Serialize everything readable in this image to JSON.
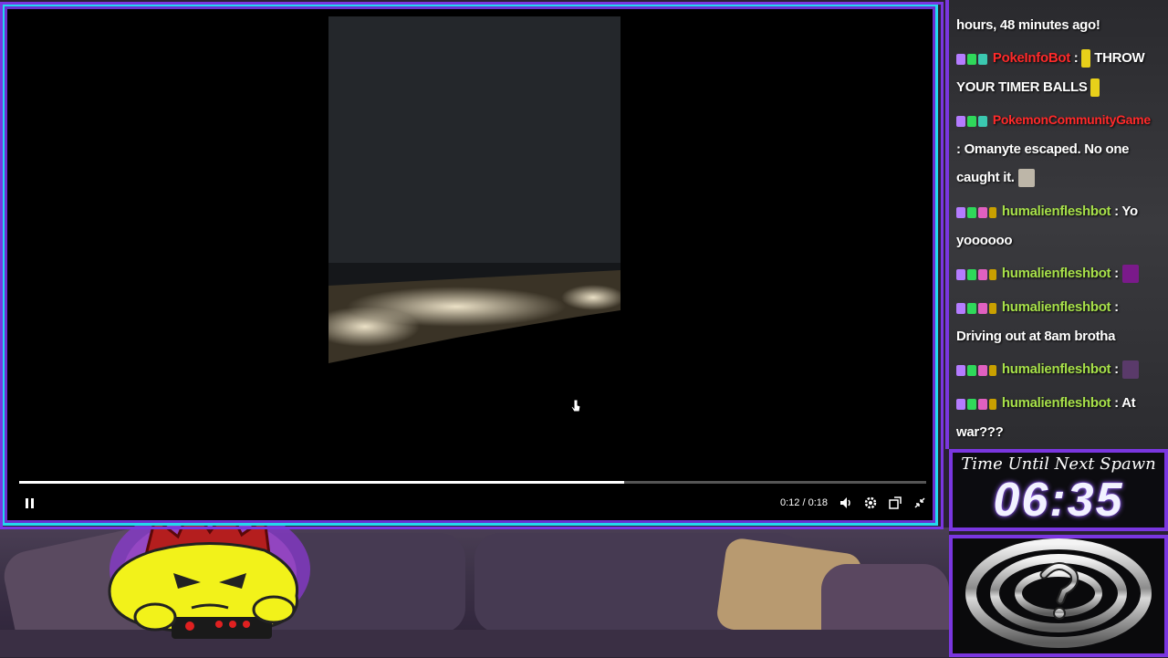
{
  "video": {
    "time_current": "0:12",
    "time_total": "0:18",
    "time_sep": " / ",
    "progress": 0.667,
    "pause_icon": "pause-icon",
    "volume_icon": "volume-icon",
    "settings_icon": "gear-icon",
    "popout_icon": "popout-icon",
    "minimize_icon": "exit-fullscreen-icon"
  },
  "chat": {
    "lines": [
      {
        "segments": [
          {
            "text": "hours, 48 minutes ago!"
          }
        ]
      },
      {
        "name": "PokeInfoBot",
        "sep": " : ",
        "text_a": " THROW",
        "cont": "YOUR TIMER BALLS"
      },
      {
        "name": "PokemonCommunityGame",
        "cont": ": Omanyte escaped. No one",
        "cont2": "caught it."
      },
      {
        "name": "humalienfleshbot",
        "sep": " : ",
        "text_a": "Yo",
        "cont": "yoooooo"
      },
      {
        "name": "humalienfleshbot",
        "sep": " : "
      },
      {
        "name": "humalienfleshbot",
        "sep": " : ",
        "cont": "Driving out at 8am brotha"
      },
      {
        "name": "humalienfleshbot",
        "sep": " : "
      },
      {
        "name": "humalienfleshbot",
        "sep": " : ",
        "text_a": "At",
        "cont": "war???"
      }
    ]
  },
  "timer": {
    "label": "Time Until Next Spawn",
    "value": "06:35"
  },
  "colors": {
    "frame_cyan": "#22d8ee",
    "frame_purple": "#7a36e0",
    "name_red": "#ff2a2a",
    "name_green": "#a7e04a"
  }
}
